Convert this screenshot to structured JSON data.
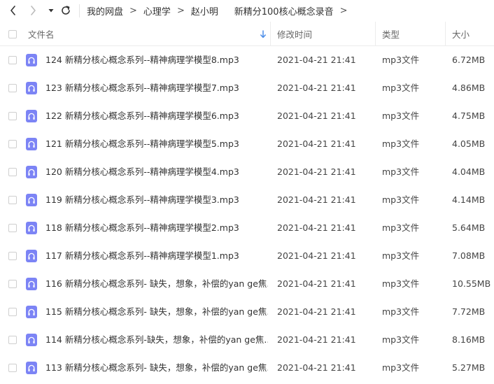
{
  "nav": {
    "back_icon": "chevron-left-icon",
    "forward_icon": "chevron-right-icon",
    "dropdown_icon": "caret-down-icon",
    "refresh_icon": "refresh-icon"
  },
  "breadcrumb": [
    "我的网盘",
    "心理学",
    "赵小明",
    "新精分100核心概念录音"
  ],
  "breadcrumb_separator": ">",
  "columns": {
    "name": "文件名",
    "modified": "修改时间",
    "type": "类型",
    "size": "大小"
  },
  "sort_indicator": "arrow-down-icon",
  "colors": {
    "accent": "#4d8ee8",
    "file_icon": "#7c84f5"
  },
  "files": [
    {
      "name": "124 新精分核心概念系列--精神病理学模型8.mp3",
      "modified": "2021-04-21 21:41",
      "type": "mp3文件",
      "size": "6.72MB"
    },
    {
      "name": "123 新精分核心概念系列--精神病理学模型7.mp3",
      "modified": "2021-04-21 21:41",
      "type": "mp3文件",
      "size": "4.86MB"
    },
    {
      "name": "122 新精分核心概念系列--精神病理学模型6.mp3",
      "modified": "2021-04-21 21:41",
      "type": "mp3文件",
      "size": "4.75MB"
    },
    {
      "name": "121 新精分核心概念系列--精神病理学模型5.mp3",
      "modified": "2021-04-21 21:41",
      "type": "mp3文件",
      "size": "4.05MB"
    },
    {
      "name": "120 新精分核心概念系列--精神病理学模型4.mp3",
      "modified": "2021-04-21 21:41",
      "type": "mp3文件",
      "size": "4.04MB"
    },
    {
      "name": "119 新精分核心概念系列--精神病理学模型3.mp3",
      "modified": "2021-04-21 21:41",
      "type": "mp3文件",
      "size": "4.14MB"
    },
    {
      "name": "118 新精分核心概念系列--精神病理学模型2.mp3",
      "modified": "2021-04-21 21:41",
      "type": "mp3文件",
      "size": "5.64MB"
    },
    {
      "name": "117 新精分核心概念系列--精神病理学模型1.mp3",
      "modified": "2021-04-21 21:41",
      "type": "mp3文件",
      "size": "7.08MB"
    },
    {
      "name": "116 新精分核心概念系列- 缺失，想象，补偿的yan ge焦...",
      "modified": "2021-04-21 21:41",
      "type": "mp3文件",
      "size": "10.55MB"
    },
    {
      "name": "115 新精分核心概念系列- 缺失，想象，补偿的yan ge焦...",
      "modified": "2021-04-21 21:41",
      "type": "mp3文件",
      "size": "7.72MB"
    },
    {
      "name": "114 新精分核心概念系列-缺失，想象，补偿的yan ge焦...",
      "modified": "2021-04-21 21:41",
      "type": "mp3文件",
      "size": "8.16MB"
    },
    {
      "name": "113 新精分核心概念系列- 缺失，想象，补偿的yan ge焦...",
      "modified": "2021-04-21 21:41",
      "type": "mp3文件",
      "size": "5.27MB"
    }
  ]
}
